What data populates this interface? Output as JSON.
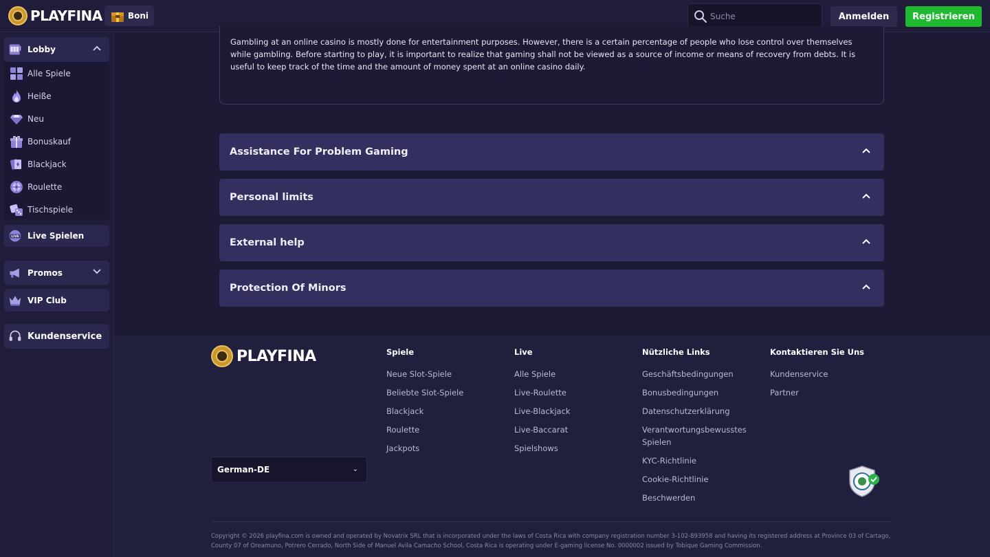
{
  "header": {
    "brand": "PLAYFINA",
    "boni_label": "Boni",
    "search_placeholder": "Suche",
    "login_label": "Anmelden",
    "register_label": "Registrieren"
  },
  "sidebar": {
    "lobby_label": "Lobby",
    "lobby_items": [
      {
        "label": "Alle Spiele",
        "icon": "grid-icon"
      },
      {
        "label": "Heiße",
        "icon": "flame-icon"
      },
      {
        "label": "Neu",
        "icon": "diamond-icon"
      },
      {
        "label": "Bonuskauf",
        "icon": "gift-icon"
      },
      {
        "label": "Blackjack",
        "icon": "cards-icon"
      },
      {
        "label": "Roulette",
        "icon": "roulette-icon"
      },
      {
        "label": "Tischspiele",
        "icon": "dice-icon"
      }
    ],
    "live_label": "Live Spielen",
    "promos_label": "Promos",
    "vip_label": "VIP Club",
    "support_label": "Kundenservice"
  },
  "main": {
    "intro_text": "Gambling at an online casino is mostly done for entertainment purposes. However, there is a certain percentage of people who lose control over themselves while gambling. Before starting to play, it is important to realize that gaming shall not be viewed as a source of income or means of recovery from debts. It is useful to keep track of the time and the amount of money spent at an online casino daily.",
    "accordions": [
      {
        "title": "Assistance For Problem Gaming"
      },
      {
        "title": "Personal limits"
      },
      {
        "title": "External help"
      },
      {
        "title": "Protection Of Minors"
      }
    ]
  },
  "footer": {
    "brand": "PLAYFINA",
    "language": "German-DE",
    "columns": [
      {
        "title": "Spiele",
        "links": [
          "Neue Slot-Spiele",
          "Beliebte Slot-Spiele",
          "Blackjack",
          "Roulette",
          "Jackpots"
        ]
      },
      {
        "title": "Live",
        "links": [
          "Alle Spiele",
          "Live-Roulette",
          "Live-Blackjack",
          "Live-Baccarat",
          "Spielshows"
        ]
      },
      {
        "title": "Nützliche Links",
        "links": [
          "Geschäftsbedingungen",
          "Bonusbedingungen",
          "Datenschutzerklärung",
          "Verantwortungsbewusstes Spielen",
          "KYC-Richtlinie",
          "Cookie-Richtlinie",
          "Beschwerden"
        ]
      },
      {
        "title": "Kontaktieren Sie Uns",
        "links": [
          "Kundenservice",
          "Partner"
        ]
      }
    ],
    "copyright": "Copyright © 2026 playfina.com is owned and operated by Novatrix SRL that is incorporated under the laws of Costa Rica with company registration number 3-102-893958 and having its registered address at Province 03 of Cartago, County 07 of Oreamuno, Potrero Cerrado, North Side of Manuel Avila Camacho School, Costa Rica is operating under E-gaming license No. 0000002 issued by Tobique Gaming Commission."
  },
  "colors": {
    "accent_green": "#1fb92f",
    "background": "#1c1a34",
    "accordion": "#332f5e"
  }
}
